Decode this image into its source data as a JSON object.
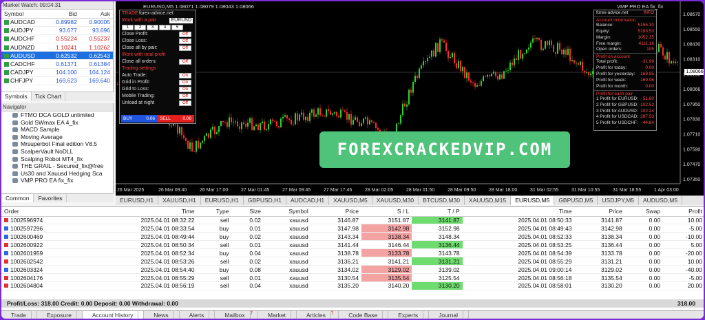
{
  "market_watch": {
    "title": "Market Watch: 09:04:31",
    "columns": [
      "Symbol",
      "Bid",
      "Ask"
    ],
    "rows": [
      {
        "symbol": "AUDCAD",
        "bid": "0.89982",
        "ask": "0.90005",
        "dir": "up"
      },
      {
        "symbol": "AUDJPY",
        "bid": "93.677",
        "ask": "93.696",
        "dir": "up"
      },
      {
        "symbol": "AUDCHF",
        "bid": "0.55224",
        "ask": "0.55237",
        "dir": "dn"
      },
      {
        "symbol": "AUDNZD",
        "bid": "1.10241",
        "ask": "1.10262",
        "dir": "dn"
      },
      {
        "symbol": "AUDUSD",
        "bid": "0.62532",
        "ask": "0.62543",
        "dir": "sel"
      },
      {
        "symbol": "CADCHF",
        "bid": "0.61371",
        "ask": "0.61384",
        "dir": "up"
      },
      {
        "symbol": "CADJPY",
        "bid": "104.100",
        "ask": "104.124",
        "dir": "up"
      },
      {
        "symbol": "CHFJPY",
        "bid": "169.623",
        "ask": "169.640",
        "dir": "up"
      }
    ],
    "tabs": [
      "Symbols",
      "Tick Chart"
    ]
  },
  "navigator": {
    "title": "Navigator",
    "items": [
      "FTMO DCA GOLD unlimited",
      "Gold SWmax EA 4_fix",
      "MACD Sample",
      "Moving Average",
      "Mrsuperbot Final edition V8.5",
      "ScalperVault NoDLL",
      "Scalping Robot MT4_fix",
      "THE GRAIL - Secured_fix@free",
      "Us30 and Xauusd Hedging Sca",
      "VMP PRO EA fix_fix"
    ],
    "tabs": [
      "Common",
      "Favorites"
    ]
  },
  "chart": {
    "header": "EURUSD,M5  1.08071 1.08079 1.08043 1.08066",
    "ea_header": "VMP PRO EA fix_fix",
    "price_tag": "1.08066",
    "price_axis": [
      "1.08670",
      "1.08550",
      "1.08430",
      "1.08310",
      "1.08190",
      "1.08066",
      "1.07950",
      "1.07830",
      "1.07710",
      "1.07590",
      "1.07470",
      "1.07350"
    ],
    "time_axis": [
      "26 Mar 2025",
      "26 Mar 09:40",
      "26 Mar 17:00",
      "27 Mar 01:45",
      "27 Mar 09:45",
      "27 Mar 17:45",
      "28 Mar 02:05",
      "28 Mar 01:50",
      "28 Mar 09:50",
      "28 Mar 18:00",
      "31 Mar 02:55",
      "31 Mar 10:55",
      "31 Mar 18:55",
      "1 Apr 03:00"
    ],
    "watermark": "FOREXCRACKEDVIP.COM",
    "chart_tabs": [
      "EURUSD,H1",
      "XAUUSD,H1",
      "EURUSD,H1",
      "GBPUSD,H1",
      "AUDCAD,H1",
      "XAUUSD,M5",
      "XAUUSD,M30",
      "BTCUSD,M30",
      "XAUUSD,M15",
      "EURUSD,M5",
      "GBPUSD,M5",
      "USDJPY,M5",
      "AUDUSD,M5"
    ],
    "active_tab": "EURUSD,M5"
  },
  "ea_panel": {
    "trade_label": "TRADE",
    "site": "forex-advice.net",
    "work_pair_label": "Work with a pair",
    "pair": "EURUSD",
    "numbers": [
      "1",
      "2",
      "3",
      "4",
      "5"
    ],
    "rows": [
      {
        "label": "Close Profit:",
        "val": "Off"
      },
      {
        "label": "Close Loss:",
        "val": "Off"
      },
      {
        "label": "Close all by pair:",
        "val": "Off"
      }
    ],
    "total_profit_label": "Work with total profit",
    "close_all_label": "Close all orders:",
    "close_all_val": "Off",
    "settings_label": "Trading settings",
    "settings": [
      {
        "label": "Auto Trade:",
        "val": "On"
      },
      {
        "label": "Grid in Profit:",
        "val": "On"
      },
      {
        "label": "Grid to Loss:",
        "val": "On"
      },
      {
        "label": "Mobile Trading:",
        "val": "Off"
      },
      {
        "label": "Unload at night",
        "val": "Off"
      }
    ],
    "buy": "BUY",
    "buy_lot": "0.06",
    "sell": "SELL",
    "sell_lot": "0.06"
  },
  "ea_info": {
    "site": "forex-advice.net",
    "info_tag": "INFO",
    "account_label": "Account information",
    "account": [
      {
        "k": "Balance:",
        "v": "5155.10"
      },
      {
        "k": "Equity:",
        "v": "5193.53"
      },
      {
        "k": "Margin:",
        "v": "1052.35"
      },
      {
        "k": "Free margin:",
        "v": "4111.16"
      },
      {
        "k": "Open orders:",
        "v": "105"
      }
    ],
    "profit_label": "Profit on account",
    "profit": [
      {
        "k": "Total profit:",
        "v": "-31.98"
      },
      {
        "k": "Profit for today:",
        "v": "0.00"
      },
      {
        "k": "Profit for yesterday:",
        "v": "169.95"
      },
      {
        "k": "Profit for week:",
        "v": "169.96"
      },
      {
        "k": "Profit for month:",
        "v": "0.00"
      }
    ],
    "pair_label": "Profit for each pair",
    "pairs": [
      {
        "k": "1  Profit for EURUSD:",
        "v": "51.60"
      },
      {
        "k": "2  Profit for GBPUSD:",
        "v": "-102.52"
      },
      {
        "k": "3  Profit for AUDUSD:",
        "v": "102.24"
      },
      {
        "k": "4  Profit for USDCAD:",
        "v": "287.53"
      },
      {
        "k": "5  Profit for USDCHF:",
        "v": "-44.84"
      }
    ]
  },
  "history": {
    "columns": [
      "Order",
      "Time",
      "Type",
      "Size",
      "Symbol",
      "Price",
      "S / L",
      "T / P",
      "Time",
      "Price",
      "Swap",
      "Profit"
    ],
    "rows": [
      {
        "order": "1002596974",
        "t1": "2025.04.01 08:32:22",
        "type": "sell",
        "size": "0.02",
        "sym": "xauusd",
        "p1": "3146.87",
        "sl": "3151.87",
        "tp": "3141.87",
        "t2": "2025.04.01 08:50:33",
        "p2": "3141.87",
        "swap": "0.00",
        "profit": "10.00",
        "hit": "tp"
      },
      {
        "order": "1002597296",
        "t1": "2025.04.01 08:33:54",
        "type": "buy",
        "size": "0.01",
        "sym": "xauusd",
        "p1": "3147.98",
        "sl": "3142.98",
        "tp": "3152.98",
        "t2": "2025.04.01 08:49:43",
        "p2": "3142.98",
        "swap": "0.00",
        "profit": "-5.00",
        "hit": "sl"
      },
      {
        "order": "1002600469",
        "t1": "2025.04.01 08:49:44",
        "type": "buy",
        "size": "0.02",
        "sym": "xauusd",
        "p1": "3143.34",
        "sl": "3138.34",
        "tp": "3148.34",
        "t2": "2025.04.01 08:52:33",
        "p2": "3138.34",
        "swap": "0.00",
        "profit": "-10.00",
        "hit": "sl"
      },
      {
        "order": "1002600922",
        "t1": "2025.04.01 08:50:34",
        "type": "sell",
        "size": "0.01",
        "sym": "xauusd",
        "p1": "3141.44",
        "sl": "3146.44",
        "tp": "3136.44",
        "t2": "2025.04.01 08:53:25",
        "p2": "3136.44",
        "swap": "0.00",
        "profit": "5.00",
        "hit": "tp"
      },
      {
        "order": "1002601959",
        "t1": "2025.04.01 08:52:34",
        "type": "buy",
        "size": "0.04",
        "sym": "xauusd",
        "p1": "3138.78",
        "sl": "3133.78",
        "tp": "3143.78",
        "t2": "2025.04.01 08:54:39",
        "p2": "3133.78",
        "swap": "0.00",
        "profit": "-20.00",
        "hit": "sl"
      },
      {
        "order": "1002602542",
        "t1": "2025.04.01 08:53:26",
        "type": "sell",
        "size": "0.02",
        "sym": "xauusd",
        "p1": "3136.21",
        "sl": "3141.21",
        "tp": "3131.21",
        "t2": "2025.04.01 08:55:29",
        "p2": "3131.21",
        "swap": "0.00",
        "profit": "10.00",
        "hit": "tp"
      },
      {
        "order": "1002603324",
        "t1": "2025.04.01 08:54:40",
        "type": "buy",
        "size": "0.08",
        "sym": "xauusd",
        "p1": "3134.02",
        "sl": "3129.02",
        "tp": "3139.02",
        "t2": "2025.04.01 09:00:14",
        "p2": "3129.02",
        "swap": "0.00",
        "profit": "-40.00",
        "hit": "sl"
      },
      {
        "order": "1002604176",
        "t1": "2025.04.01 08:55:29",
        "type": "sell",
        "size": "0.01",
        "sym": "xauusd",
        "p1": "3130.54",
        "sl": "3135.54",
        "tp": "3125.54",
        "t2": "2025.04.01 08:56:18",
        "p2": "3135.54",
        "swap": "0.00",
        "profit": "-5.00",
        "hit": "sl"
      },
      {
        "order": "1002604804",
        "t1": "2025.04.01 08:56:19",
        "type": "sell",
        "size": "0.04",
        "sym": "xauusd",
        "p1": "3135.20",
        "sl": "3140.20",
        "tp": "3130.20",
        "t2": "2025.04.01 08:58:01",
        "p2": "3130.20",
        "swap": "0.00",
        "profit": "20.00",
        "hit": "tp"
      }
    ],
    "total": "Profit/Loss: 318.00  Credit: 0.00  Deposit: 0.00  Withdrawal: 0.00",
    "total_right": "318.00"
  },
  "bottom_tabs": [
    {
      "label": "Trade",
      "badge": ""
    },
    {
      "label": "Exposure",
      "badge": ""
    },
    {
      "label": "Account History",
      "badge": ""
    },
    {
      "label": "News",
      "badge": ""
    },
    {
      "label": "Alerts",
      "badge": ""
    },
    {
      "label": "Mailbox",
      "badge": "7"
    },
    {
      "label": "Market",
      "badge": ""
    },
    {
      "label": "Articles",
      "badge": "7"
    },
    {
      "label": "Code Base",
      "badge": ""
    },
    {
      "label": "Experts",
      "badge": ""
    },
    {
      "label": "Journal",
      "badge": ""
    }
  ],
  "active_bottom_tab": "Account History",
  "colors": {
    "accent": "#7a2bd6",
    "up_candle": "#2fd12f",
    "down_candle": "#ff2a2a",
    "watermark": "#4fc37a"
  }
}
